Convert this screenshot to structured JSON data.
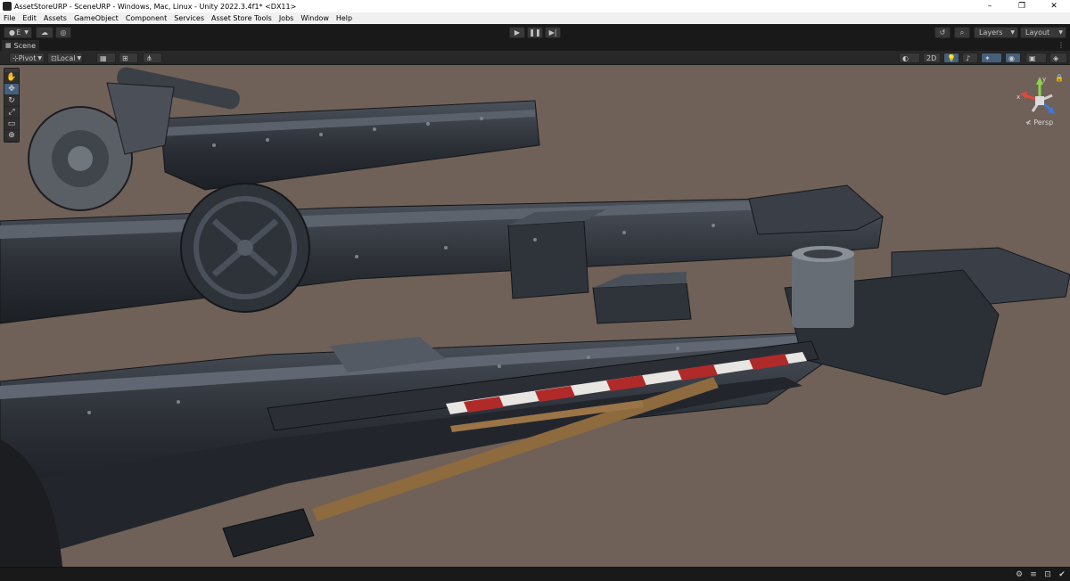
{
  "window": {
    "title": "AssetStoreURP - SceneURP - Windows, Mac, Linux - Unity 2022.3.4f1* <DX11>",
    "controls": [
      "–",
      "❐",
      "✕"
    ]
  },
  "menu": [
    "File",
    "Edit",
    "Assets",
    "GameObject",
    "Component",
    "Services",
    "Asset Store Tools",
    "Jobs",
    "Window",
    "Help"
  ],
  "toolbar": {
    "account_label": "E",
    "layers_label": "Layers",
    "layout_label": "Layout"
  },
  "tab": {
    "label": "Scene"
  },
  "scene_toolbar": {
    "pivot_label": "Pivot",
    "local_label": "Local",
    "mode_2d_label": "2D"
  },
  "gizmo": {
    "projection_label": "Persp",
    "axis_y": "y",
    "axis_x": "x"
  },
  "colors": {
    "editor_bg": "#191919",
    "scene_bg": "#6f6158",
    "accent": "#46607c"
  }
}
